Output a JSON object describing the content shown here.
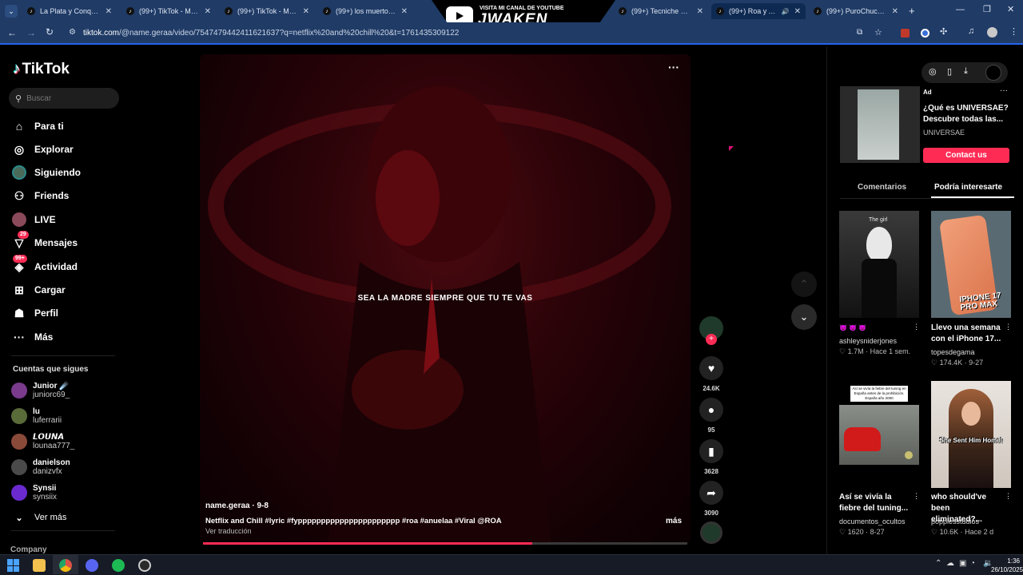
{
  "browser": {
    "tabs": [
      {
        "label": "La Plata y Conquistar"
      },
      {
        "label": "(99+) TikTok - Make Y"
      },
      {
        "label": "(99+) TikTok - Make Y"
      },
      {
        "label": "(99+) los muertos can"
      },
      {
        "label": "(99+) Tecniche di gioc"
      },
      {
        "label": "(99+) Roa y Anuel"
      },
      {
        "label": "(99+) PuroChucu777"
      }
    ],
    "banner_small": "VISITA MI CANAL DE YOUTUBE",
    "banner_big": "JWAKEN",
    "url_host": "tiktok.com",
    "url_path": "/@name.geraa/video/7547479442411621637?q=netflix%20and%20chill%20&t=1761435309122"
  },
  "sidebar": {
    "logo": "TikTok",
    "search_placeholder": "Buscar",
    "nav": [
      {
        "label": "Para ti",
        "icon": "home-icon"
      },
      {
        "label": "Explorar",
        "icon": "compass-icon"
      },
      {
        "label": "Siguiendo",
        "icon": "following-avatar-icon"
      },
      {
        "label": "Friends",
        "icon": "friends-icon"
      },
      {
        "label": "LIVE",
        "icon": "live-icon"
      },
      {
        "label": "Mensajes",
        "icon": "messages-icon",
        "badge": "29"
      },
      {
        "label": "Actividad",
        "icon": "activity-icon",
        "badge": "99+"
      },
      {
        "label": "Cargar",
        "icon": "upload-icon"
      },
      {
        "label": "Perfil",
        "icon": "profile-icon"
      },
      {
        "label": "Más",
        "icon": "more-icon"
      }
    ],
    "following_title": "Cuentas que sigues",
    "following": [
      {
        "name": "Junior ☄️",
        "handle": "juniorc69_",
        "color": "#7a3b8c"
      },
      {
        "name": "lu",
        "handle": "luferrarii",
        "color": "#5a6b3a"
      },
      {
        "name": "𝙇𝙊𝙐𝙉𝘼",
        "handle": "lounaa777_",
        "color": "#8a4a3a"
      },
      {
        "name": "danielson",
        "handle": "danizvfx",
        "color": "#4a4a4a"
      },
      {
        "name": "Synsii",
        "handle": "synsiix",
        "color": "#6a2ad0"
      }
    ],
    "see_more": "Ver más",
    "company": "Company"
  },
  "video": {
    "lyric": "SEA LA MADRE SIEMPRE QUE TU TE VAS",
    "author": "name.geraa",
    "date": "9-8",
    "caption": "Netflix and Chill #lyric #fypppppppppppppppppppppp #roa #anuelaa #Viral @ROA",
    "more": "más",
    "translate": "Ver traducción",
    "progress": 0.68,
    "likes": "24.6K",
    "comments": "95",
    "saves": "3628",
    "shares": "3090"
  },
  "right_panel": {
    "ad_label": "Ad",
    "ad_title": "¿Qué es UNIVERSAE? Descubre todas las...",
    "ad_brand": "UNIVERSAE",
    "ad_button": "Contact us",
    "tabs": [
      "Comentarios",
      "Podría interesarte"
    ],
    "thumb_texts": [
      "The girl",
      "IPHONE 17 PRO MAX",
      "Así se vivía la fiebre del tuning en España antes de la prohibición. España año 2000",
      "She Sent Him Home!"
    ],
    "cards": [
      {
        "title": "😈 😈 😈",
        "author": "ashleysniderjones",
        "likes": "1.7M",
        "age": "Hace 1 sem."
      },
      {
        "title": "Llevo una semana con el iPhone 17...",
        "author": "topesdegama",
        "likes": "174.4K",
        "age": "9-27"
      },
      {
        "title": "Así se vivía la fiebre del tuning...",
        "author": "documentos_ocultos",
        "likes": "1620",
        "age": "8-27"
      },
      {
        "title": "who should've been eliminated?...",
        "author": "poppiesstudios",
        "likes": "10.6K",
        "age": "Hace 2 d"
      }
    ]
  },
  "taskbar": {
    "time": "1:36",
    "date": "26/10/2025"
  }
}
